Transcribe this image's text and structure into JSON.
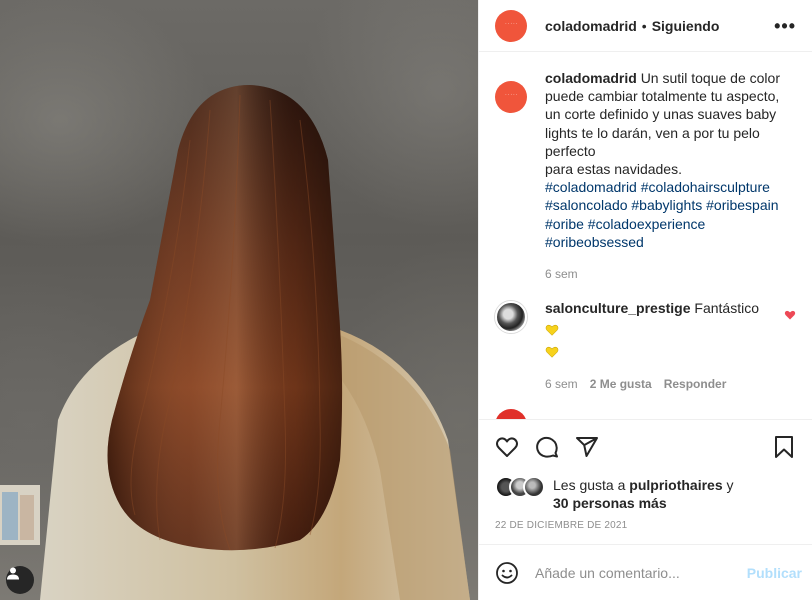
{
  "post": {
    "username": "coladomadrid",
    "follow_label": "Siguiendo",
    "more_label": "•••",
    "caption_user": "coladomadrid",
    "caption_lines": [
      "Un sutil toque de color",
      "puede cambiar totalmente tu aspecto,",
      "un corte definido y unas suaves baby",
      "lights te lo darán, ven a por tu pelo",
      "perfecto",
      "para estas navidades."
    ],
    "hashtags": [
      "#coladomadrid #coladohairsculpture",
      "#saloncolado #babylights #oribespain",
      "#oribe #coladoexperience",
      "#oribeobsessed"
    ],
    "caption_time": "6 sem"
  },
  "comments": [
    {
      "username": "salonculture_prestige",
      "text": "Fantástico",
      "time": "6 sem",
      "likes": "2 Me gusta",
      "reply": "Responder"
    }
  ],
  "likes": {
    "prefix": "Les gusta a",
    "user": "pulpriothaires",
    "suffix": "y",
    "others": "30 personas más"
  },
  "date": "22 DE DICIEMBRE DE 2021",
  "add_comment": {
    "placeholder": "Añade un comentario...",
    "publish": "Publicar"
  },
  "colors": {
    "brand_avatar": "#f0553b",
    "hashtag": "#00376b",
    "muted": "#8e8e8e",
    "publish_disabled": "#b2dffc",
    "like_red": "#ed4956"
  }
}
